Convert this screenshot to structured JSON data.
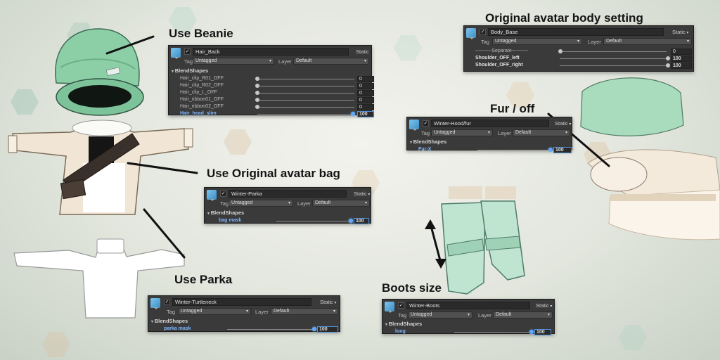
{
  "callouts": {
    "beanie": "Use Beanie",
    "bag": "Use Original avatar bag",
    "parka": "Use Parka",
    "body_setting": "Original avatar body setting",
    "fur": "Fur / off",
    "boots": "Boots size"
  },
  "inspectors": {
    "hair_back": {
      "name": "Hair_Back",
      "static": "Static",
      "tag_label": "Tag",
      "tag": "Untagged",
      "layer_label": "Layer",
      "layer": "Default",
      "section": "BlendShapes",
      "blendshapes": [
        {
          "name": "Hair_clip_R01_OFF",
          "value": "0"
        },
        {
          "name": "Hair_clip_R02_OFF",
          "value": "0"
        },
        {
          "name": "Hair_clip_L_OFF",
          "value": "0"
        },
        {
          "name": "Hair_ribbon01_OFF",
          "value": "0"
        },
        {
          "name": "Hair_ribbon02_OFF",
          "value": "0"
        },
        {
          "name": "Hair_head_slim",
          "value": "100"
        }
      ]
    },
    "parka": {
      "name": "Winter-Parka",
      "static": "Static",
      "tag_label": "Tag",
      "tag": "Untagged",
      "layer_label": "Layer",
      "layer": "Default",
      "section": "BlendShapes",
      "blendshapes": [
        {
          "name": "bag mask",
          "value": "100"
        }
      ]
    },
    "turtleneck": {
      "name": "Winter-Turtleneck",
      "static": "Static",
      "tag_label": "Tag",
      "tag": "Untagged",
      "layer_label": "Layer",
      "layer": "Default",
      "section": "BlendShapes",
      "blendshapes": [
        {
          "name": "parka mask",
          "value": "100"
        }
      ]
    },
    "body_base": {
      "name": "Body_Base",
      "static": "Static",
      "tag_label": "Tag",
      "tag": "Untagged",
      "layer_label": "Layer",
      "layer": "Default",
      "separator": {
        "name": "----------Separate----------",
        "value": "0"
      },
      "blendshapes": [
        {
          "name": "Shoulder_OFF_left",
          "value": "100"
        },
        {
          "name": "Shoulder_OFF_right",
          "value": "100"
        }
      ]
    },
    "hood_fur": {
      "name": "Winter-Hood/fur",
      "static": "Static",
      "tag_label": "Tag",
      "tag": "Untagged",
      "layer_label": "Layer",
      "layer": "Default",
      "section": "BlendShapes",
      "blendshapes": [
        {
          "name": "Fur-X",
          "value": "100"
        }
      ]
    },
    "boots": {
      "name": "Winter-Boots",
      "static": "Static",
      "tag_label": "Tag",
      "tag": "Untagged",
      "layer_label": "Layer",
      "layer": "Default",
      "section": "BlendShapes",
      "blendshapes": [
        {
          "name": "long",
          "value": "100"
        }
      ]
    }
  },
  "colors": {
    "panel_bg": "#3a3a3a",
    "beanie_green": "#8ccfa6",
    "parka_cream": "#f1e6d6",
    "highlight_blue": "#7fb6ff"
  }
}
